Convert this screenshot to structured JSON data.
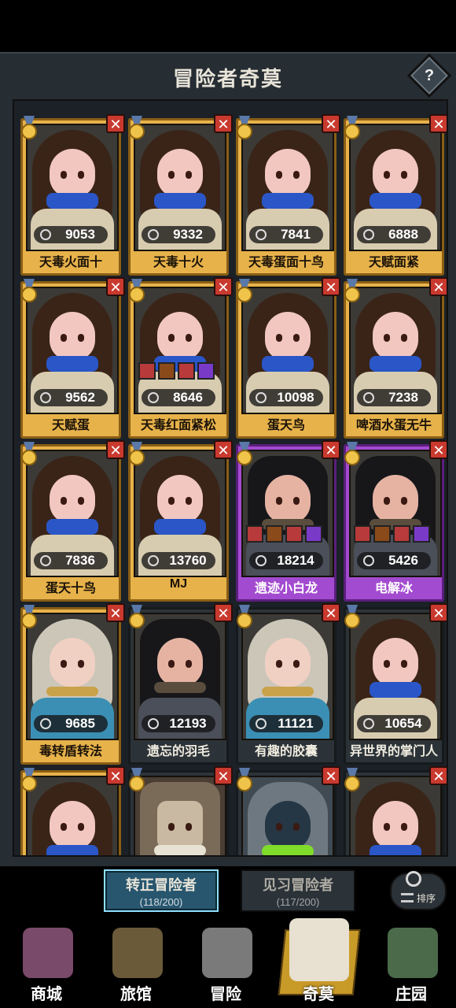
{
  "panel": {
    "title": "冒险者奇莫",
    "help_label": "?"
  },
  "cards": [
    {
      "name": "天毒火面十",
      "value": "9053",
      "style": "gold",
      "portrait": "girl",
      "stat_icon": "target-icon"
    },
    {
      "name": "天毒十火",
      "value": "9332",
      "style": "gold",
      "portrait": "girl",
      "stat_icon": "target-icon"
    },
    {
      "name": "天毒蛋面十鸟",
      "value": "7841",
      "style": "gold",
      "portrait": "girl",
      "stat_icon": "target-icon"
    },
    {
      "name": "天赋面紧",
      "value": "6888",
      "style": "gold",
      "portrait": "girl",
      "stat_icon": "target-icon"
    },
    {
      "name": "天赋蛋",
      "value": "9562",
      "style": "gold",
      "portrait": "girl",
      "stat_icon": "target-icon"
    },
    {
      "name": "天毒红面紧松",
      "value": "8646",
      "style": "gold",
      "portrait": "girl",
      "stat_icon": "target-icon"
    },
    {
      "name": "蛋天鸟",
      "value": "10098",
      "style": "gold",
      "portrait": "girl",
      "stat_icon": "target-icon"
    },
    {
      "name": "啤酒水蛋无牛",
      "value": "7238",
      "style": "gold",
      "portrait": "girl",
      "stat_icon": "sword-icon"
    },
    {
      "name": "蛋天十鸟",
      "value": "7836",
      "style": "gold",
      "portrait": "girl",
      "stat_icon": "target-icon"
    },
    {
      "name": "MJ",
      "value": "13760",
      "style": "gold",
      "portrait": "girl",
      "stat_icon": "claw-icon"
    },
    {
      "name": "遗迹小白龙",
      "value": "18214",
      "style": "purple",
      "portrait": "monster",
      "stat_icon": "claw-icon"
    },
    {
      "name": "电解冰",
      "value": "5426",
      "style": "purple",
      "portrait": "monster",
      "stat_icon": "claw-icon"
    },
    {
      "name": "毒转盾转法",
      "value": "9685",
      "style": "gold",
      "portrait": "elf",
      "stat_icon": "leaf-icon"
    },
    {
      "name": "遗忘的羽毛",
      "value": "12193",
      "style": "dark",
      "portrait": "monster",
      "stat_icon": "leaf-icon"
    },
    {
      "name": "有趣的胶囊",
      "value": "11121",
      "style": "dark",
      "portrait": "elf",
      "stat_icon": "leaf-icon"
    },
    {
      "name": "异世界的掌门人",
      "value": "10654",
      "style": "dark",
      "portrait": "girl",
      "stat_icon": "target-icon"
    },
    {
      "name": "",
      "value": "",
      "style": "gold",
      "portrait": "girl",
      "stat_icon": ""
    },
    {
      "name": "",
      "value": "",
      "style": "dark",
      "portrait": "skull",
      "stat_icon": ""
    },
    {
      "name": "",
      "value": "",
      "style": "dark",
      "portrait": "robot",
      "stat_icon": ""
    },
    {
      "name": "",
      "value": "",
      "style": "dark",
      "portrait": "girl",
      "stat_icon": ""
    }
  ],
  "sort": {
    "label": "排序"
  },
  "tabs": [
    {
      "title": "转正冒险者",
      "count": "(118/200)",
      "active": true
    },
    {
      "title": "见习冒险者",
      "count": "(117/200)",
      "active": false
    }
  ],
  "nav": [
    {
      "label": "商城",
      "icon": "shop-icon",
      "color": "#7a4a6a"
    },
    {
      "label": "旅馆",
      "icon": "inn-icon",
      "color": "#6a5a3a"
    },
    {
      "label": "冒险",
      "icon": "crossed-swords-icon",
      "color": "#7a7a7a"
    },
    {
      "label": "奇莫",
      "icon": "kimo-icon",
      "color": "#e8e0d0",
      "active": true
    },
    {
      "label": "庄园",
      "icon": "manor-icon",
      "color": "#4a6a4a"
    }
  ],
  "colors": {
    "gold_card": "#e7b24a",
    "purple_card": "#a34bd0",
    "close": "#c9392e",
    "active_tab": "#27566e"
  }
}
